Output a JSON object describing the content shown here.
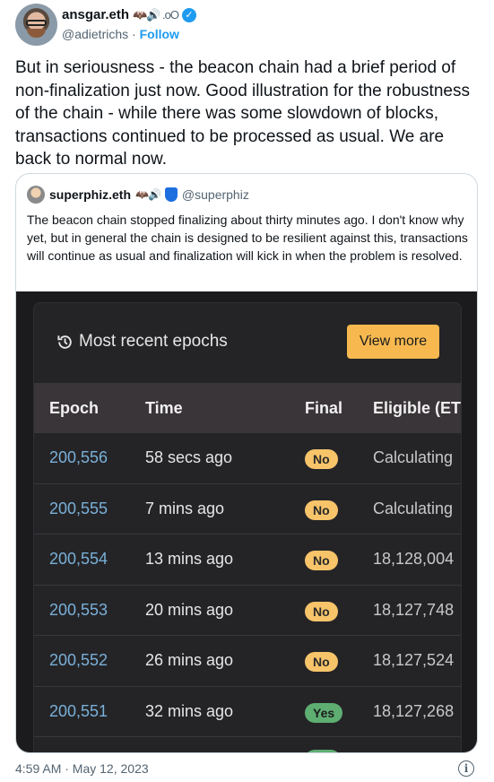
{
  "author": {
    "name": "ansgar.eth",
    "name_decoration": "🦇🔊 .oO",
    "handle": "@adietrichs",
    "separator": "·",
    "follow_label": "Follow"
  },
  "tweet": {
    "text": "But in seriousness - the beacon chain had a brief period of non-finalization just now. Good illustration for the robustness of the chain - while there was some slowdown of blocks, transactions continued to be processed as usual. We are back to normal now."
  },
  "quote": {
    "name": "superphiz.eth",
    "name_decoration": "🦇🔊",
    "handle": "@superphiz",
    "text": "The beacon chain stopped finalizing about thirty minutes ago. I don't know why yet, but in general the chain is designed to be resilient against this, transactions will continue as usual and finalization will kick in when the problem is resolved."
  },
  "epochs_panel": {
    "title": "Most recent epochs",
    "view_more_label": "View more",
    "columns": [
      "Epoch",
      "Time",
      "Final",
      "Eligible (ET"
    ],
    "rows": [
      {
        "epoch": "200,556",
        "time": "58 secs ago",
        "final": "No",
        "eligible": "Calculating"
      },
      {
        "epoch": "200,555",
        "time": "7 mins ago",
        "final": "No",
        "eligible": "Calculating"
      },
      {
        "epoch": "200,554",
        "time": "13 mins ago",
        "final": "No",
        "eligible": "18,128,004"
      },
      {
        "epoch": "200,553",
        "time": "20 mins ago",
        "final": "No",
        "eligible": "18,127,748"
      },
      {
        "epoch": "200,552",
        "time": "26 mins ago",
        "final": "No",
        "eligible": "18,127,524"
      },
      {
        "epoch": "200,551",
        "time": "32 mins ago",
        "final": "Yes",
        "eligible": "18,127,268"
      }
    ]
  },
  "footer": {
    "timestamp": "4:59 AM · May 12, 2023",
    "info_icon": "info-icon"
  },
  "colors": {
    "link_blue": "#1d9bf0",
    "view_more_bg": "#f7b94f",
    "badge_no": "#f7c46a",
    "badge_yes": "#5eae72",
    "epoch_link": "#7ab0d8"
  }
}
